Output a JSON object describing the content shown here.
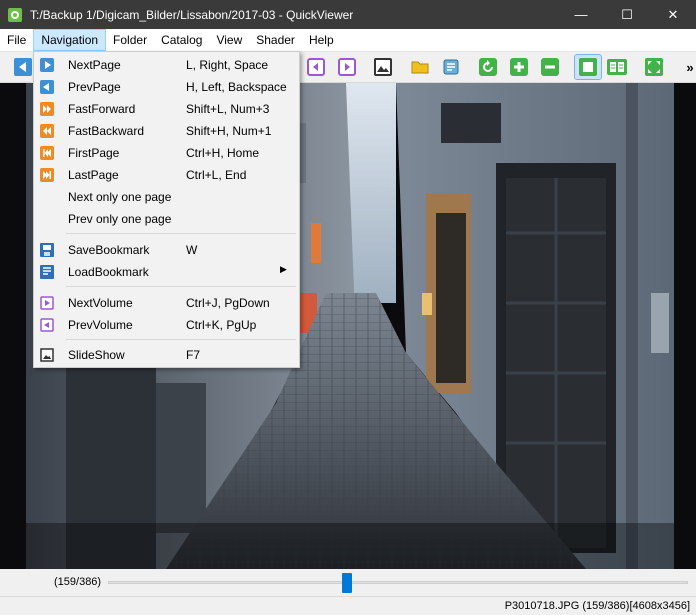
{
  "window": {
    "title": "T:/Backup 1/Digicam_Bilder/Lissabon/2017-03 - QuickViewer",
    "minimize_glyph": "—",
    "maximize_glyph": "☐",
    "close_glyph": "✕"
  },
  "menubar": {
    "items": [
      "File",
      "Navigation",
      "Folder",
      "Catalog",
      "View",
      "Shader",
      "Help"
    ],
    "active": "Navigation"
  },
  "toolbar": {
    "overflow_glyph": "»",
    "icons": [
      "prev-page-icon",
      "prev-volume-icon",
      "next-volume-icon",
      "slideshow-icon",
      "open-folder-icon",
      "catalog-icon",
      "rotate-icon",
      "zoom-in-icon",
      "zoom-out-icon",
      "fit-window-icon",
      "dual-view-icon",
      "fullscreen-icon"
    ],
    "pressed": "fit-window-icon"
  },
  "navigation_menu": {
    "items": [
      {
        "label": "NextPage",
        "shortcut": "L, Right, Space",
        "icon": "next-page-icon"
      },
      {
        "label": "PrevPage",
        "shortcut": "H, Left, Backspace",
        "icon": "prev-page-icon"
      },
      {
        "label": "FastForward",
        "shortcut": "Shift+L, Num+3",
        "icon": "fast-forward-icon"
      },
      {
        "label": "FastBackward",
        "shortcut": "Shift+H, Num+1",
        "icon": "fast-backward-icon"
      },
      {
        "label": "FirstPage",
        "shortcut": "Ctrl+H, Home",
        "icon": "first-page-icon"
      },
      {
        "label": "LastPage",
        "shortcut": "Ctrl+L, End",
        "icon": "last-page-icon"
      },
      {
        "label": "Next only one page",
        "shortcut": "",
        "icon": ""
      },
      {
        "label": "Prev only one page",
        "shortcut": "",
        "icon": ""
      },
      {
        "label": "SaveBookmark",
        "shortcut": "W",
        "icon": "save-bookmark-icon"
      },
      {
        "label": "LoadBookmark",
        "shortcut": "",
        "icon": "load-bookmark-icon",
        "submenu": true
      },
      {
        "label": "NextVolume",
        "shortcut": "Ctrl+J, PgDown",
        "icon": "next-volume-icon"
      },
      {
        "label": "PrevVolume",
        "shortcut": "Ctrl+K, PgUp",
        "icon": "prev-volume-icon"
      },
      {
        "label": "SlideShow",
        "shortcut": "F7",
        "icon": "slideshow-icon"
      }
    ],
    "submenu_arrow": "▶"
  },
  "slider": {
    "page_count": "(159/386)",
    "value": 159,
    "max": 386
  },
  "statusbar": {
    "text": "P3010718.JPG (159/386)[4608x3456]"
  },
  "colors": {
    "titlebar": "#3a3a3a",
    "accent": "#0078d7",
    "menu_highlight": "#cce8ff",
    "icon_blue": "#3d8fd6",
    "icon_orange": "#f08a24",
    "icon_purple": "#9b59d0",
    "icon_green": "#44b24a",
    "icon_yellow": "#f0c020"
  }
}
